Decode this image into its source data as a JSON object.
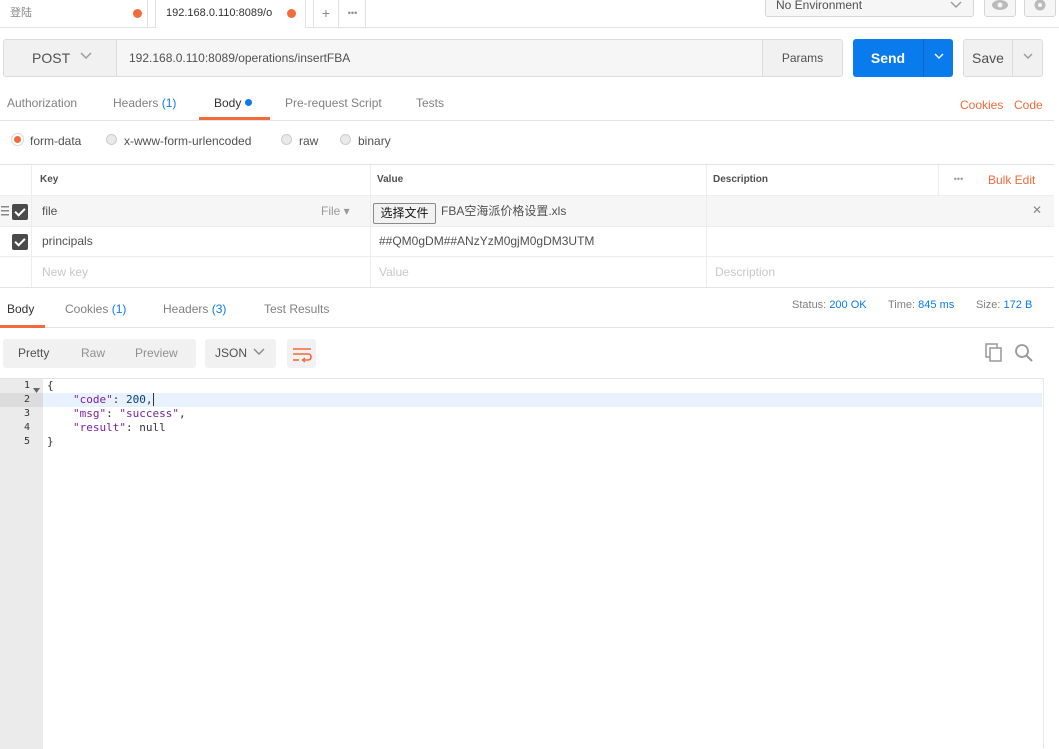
{
  "tabs": {
    "tab1_title": "登陆",
    "tab2_title": "192.168.0.110:8089/o",
    "add_label": "+",
    "more_label": "•••"
  },
  "environment": {
    "selected": "No Environment"
  },
  "request": {
    "method": "POST",
    "url": "192.168.0.110:8089/operations/insertFBA",
    "params_label": "Params",
    "send_label": "Send",
    "save_label": "Save"
  },
  "request_tabs": {
    "authorization": "Authorization",
    "headers": "Headers",
    "headers_count": "(1)",
    "body": "Body",
    "prerequest": "Pre-request Script",
    "tests": "Tests",
    "cookies": "Cookies",
    "code": "Code"
  },
  "body_types": {
    "form_data": "form-data",
    "urlencoded": "x-www-form-urlencoded",
    "raw": "raw",
    "binary": "binary"
  },
  "kv_table": {
    "headers": {
      "key": "Key",
      "value": "Value",
      "description": "Description",
      "dots": "•••",
      "bulk_edit": "Bulk Edit"
    },
    "rows": [
      {
        "key": "file",
        "type": "File ▾",
        "choose_button": "选择文件",
        "value": "FBA空海派价格设置.xls",
        "remove": "✕"
      },
      {
        "key": "principals",
        "value": "##QM0gDM##ANzYzM0gjM0gDM3UTM"
      }
    ],
    "placeholder": {
      "key": "New key",
      "value": "Value",
      "description": "Description"
    }
  },
  "response_tabs": {
    "body": "Body",
    "cookies": "Cookies",
    "cookies_count": "(1)",
    "headers": "Headers",
    "headers_count": "(3)",
    "test_results": "Test Results"
  },
  "response_status": {
    "status_label": "Status:",
    "status_value": "200 OK",
    "time_label": "Time:",
    "time_value": "845 ms",
    "size_label": "Size:",
    "size_value": "172 B"
  },
  "format_bar": {
    "pretty": "Pretty",
    "raw": "Raw",
    "preview": "Preview",
    "format": "JSON"
  },
  "response_body": {
    "line_numbers": [
      "1",
      "2",
      "3",
      "4",
      "5"
    ],
    "l1": "{",
    "l2_key": "\"code\"",
    "l2_colon": ": ",
    "l2_val": "200",
    "l2_tail": ",",
    "l3_key": "\"msg\"",
    "l3_colon": ": ",
    "l3_val": "\"success\"",
    "l3_tail": ",",
    "l4_key": "\"result\"",
    "l4_colon": ": ",
    "l4_val": "null",
    "l5": "}"
  },
  "colors": {
    "accent": "#f26b3a",
    "send_blue": "#097bed"
  }
}
